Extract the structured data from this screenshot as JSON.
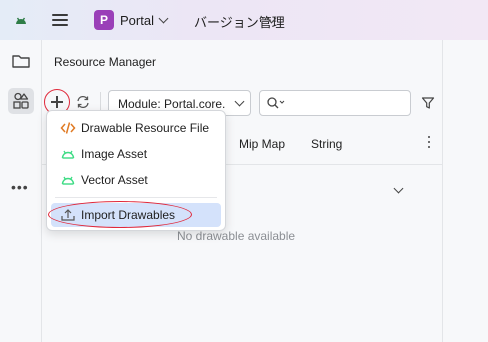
{
  "titlebar": {
    "project_badge": "P",
    "project_name": "Portal",
    "vcs_label": "バージョン管理"
  },
  "left_strip": {
    "items": [
      {
        "icon": "folder-icon"
      },
      {
        "icon": "resource-manager-icon",
        "active": true
      },
      {
        "icon": "more-icon",
        "label": "•••"
      }
    ]
  },
  "resource_manager": {
    "title": "Resource Manager",
    "module_select": {
      "value": "Module: Portal.core."
    },
    "search": {
      "value": ""
    },
    "tabs": [
      "Mip Map",
      "String"
    ],
    "empty_message": "No drawable available"
  },
  "add_menu": {
    "items": [
      {
        "label": "Drawable Resource File",
        "icon": "code-icon"
      },
      {
        "label": "Image Asset",
        "icon": "android-icon"
      },
      {
        "label": "Vector Asset",
        "icon": "android-icon"
      },
      {
        "label": "Import Drawables",
        "icon": "import-icon",
        "selected": true
      }
    ]
  },
  "colors": {
    "accent_purple": "#9a3fb8",
    "highlight_red": "#e0283a",
    "selection_blue": "#d4e2fb",
    "android_green": "#3ddc84",
    "code_orange": "#e07a23"
  }
}
